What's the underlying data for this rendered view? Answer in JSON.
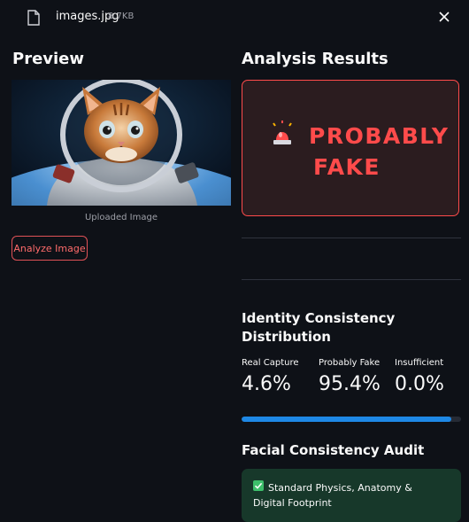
{
  "file": {
    "name": "images.jpg",
    "size": "8.7KB",
    "icon": "file-icon",
    "close_icon": "close-icon"
  },
  "preview": {
    "title": "Preview",
    "caption": "Uploaded Image",
    "image_alt": "Cat in astronaut suit",
    "analyze_button": "Analyze Image"
  },
  "results": {
    "title": "Analysis Results",
    "verdict_line1": "PROBABLY",
    "verdict_line2": "FAKE",
    "verdict_icon": "alarm-siren-icon",
    "verdict_color": "#ff4b4b"
  },
  "distribution": {
    "title": "Identity Consistency Distribution",
    "metrics": [
      {
        "label": "Real Capture",
        "value": "4.6%"
      },
      {
        "label": "Probably Fake",
        "value": "95.4%"
      },
      {
        "label": "Insufficient",
        "value": "0.0%"
      }
    ],
    "progress_fraction": 0.954,
    "progress_color": "#1e88e5"
  },
  "audit": {
    "title": "Facial Consistency Audit",
    "item_text": "Standard Physics, Anatomy & Digital Footprint",
    "item_icon": "check-box-icon",
    "item_bg": "#17382a"
  }
}
